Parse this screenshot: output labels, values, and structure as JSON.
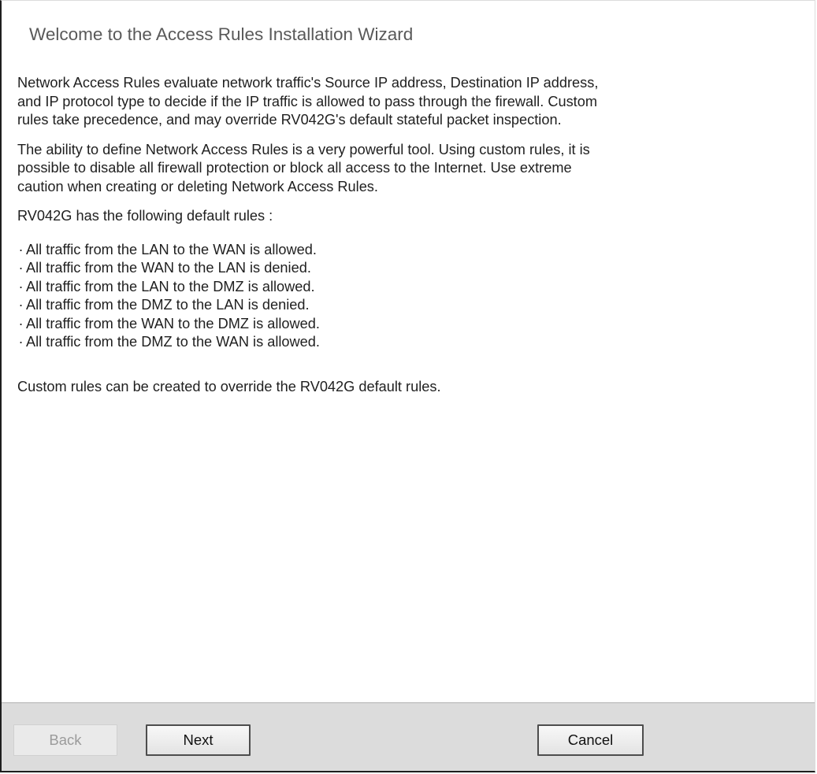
{
  "wizard": {
    "title": "Welcome to the Access Rules Installation Wizard",
    "intro_lines": [
      "Network Access Rules evaluate network traffic's Source IP address, Destination IP address,",
      "and IP protocol type to decide if the IP traffic is allowed to pass through the firewall. Custom",
      "rules take precedence, and may override RV042G's default stateful packet inspection."
    ],
    "warning_lines": [
      "The ability to define Network Access Rules is a very powerful tool. Using custom rules, it is",
      "possible to disable all firewall protection or block all access to the Internet. Use extreme",
      "caution when creating or deleting Network Access Rules."
    ],
    "defaults_heading": "RV042G has the following default rules :",
    "bullet_glyph": "·",
    "default_rules": [
      "All traffic from the LAN to the WAN is allowed.",
      "All traffic from the WAN to the LAN is denied.",
      "All traffic from the LAN to the DMZ is allowed.",
      "All traffic from the DMZ to the LAN is denied.",
      "All traffic from the WAN to the DMZ is allowed.",
      "All traffic from the DMZ to the WAN is allowed."
    ],
    "closing": "Custom rules can be created to override the RV042G default rules."
  },
  "footer": {
    "back_label": "Back",
    "next_label": "Next",
    "cancel_label": "Cancel"
  },
  "colors": {
    "title": "#595959",
    "body_text": "#1f1f1f",
    "footer_bg": "#dcdcdc",
    "disabled_text": "#9b9b9b"
  }
}
